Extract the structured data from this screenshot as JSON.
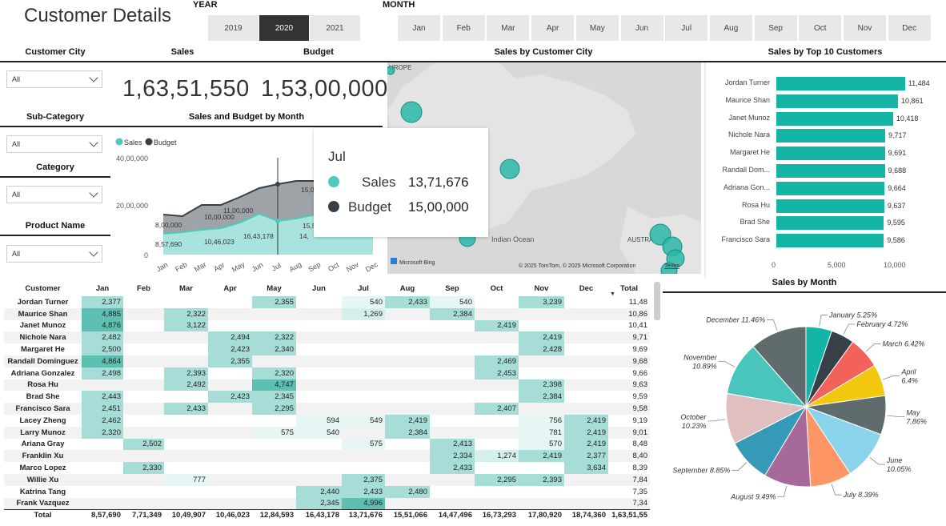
{
  "title": "Customer Details",
  "year": {
    "label": "YEAR",
    "options": [
      "2019",
      "2020",
      "2021"
    ],
    "selected": "2020"
  },
  "month": {
    "label": "MONTH",
    "options": [
      "Jan",
      "Feb",
      "Mar",
      "Apr",
      "May",
      "Jun",
      "Jul",
      "Aug",
      "Sep",
      "Oct",
      "Nov",
      "Dec"
    ]
  },
  "filters": {
    "city": {
      "label": "Customer City",
      "value": "All"
    },
    "subcategory": {
      "label": "Sub-Category",
      "value": "All"
    },
    "category": {
      "label": "Category",
      "value": "All"
    },
    "product": {
      "label": "Product Name",
      "value": "All"
    }
  },
  "kpi": {
    "sales_label": "Sales",
    "sales_value": "1,63,51,550",
    "budget_label": "Budget",
    "budget_value": "1,53,00,000"
  },
  "line_chart": {
    "title": "Sales and Budget by Month",
    "legend": [
      "Sales",
      "Budget"
    ],
    "ytick_labels": [
      "40,00,000",
      "20,00,000",
      "0"
    ],
    "month_labels": [
      "Jan",
      "Feb",
      "Mar",
      "Apr",
      "May",
      "Jun",
      "Jul",
      "Aug",
      "Sep",
      "Oct",
      "Nov",
      "Dec"
    ],
    "visible_labels": [
      "8,00,000",
      "8,57,690",
      "10,00,000",
      "10,46,023",
      "11,00,000",
      "16,43,178",
      "15,00,000",
      "15,51,0",
      "14,"
    ],
    "colors": {
      "sales": "#4ec9be",
      "budget": "#374047"
    }
  },
  "map": {
    "title": "Sales by Customer City",
    "labels": {
      "europe": "UROPE",
      "ocean": "Indian Ocean",
      "aus": "AUSTRA"
    },
    "bing": "Microsoft Bing",
    "copyright": "© 2025 TomTom, © 2025 Microsoft Corporation",
    "terms": "Terms",
    "bubble_color": "#2ab7a9"
  },
  "tooltip": {
    "month": "Jul",
    "sales_label": "Sales",
    "sales_value": "13,71,676",
    "budget_label": "Budget",
    "budget_value": "15,00,000"
  },
  "top10": {
    "title": "Sales by Top 10 Customers",
    "axis": [
      "0",
      "5,000",
      "10,000"
    ],
    "bar_color": "#14b5a6",
    "items": [
      {
        "name": "Jordan Turner",
        "value": 11484,
        "label": "11,484"
      },
      {
        "name": "Maurice Shan",
        "value": 10861,
        "label": "10,861"
      },
      {
        "name": "Janet Munoz",
        "value": 10418,
        "label": "10,418"
      },
      {
        "name": "Nichole Nara",
        "value": 9717,
        "label": "9,717"
      },
      {
        "name": "Margaret He",
        "value": 9691,
        "label": "9,691"
      },
      {
        "name": "Randall Dom...",
        "value": 9688,
        "label": "9,688"
      },
      {
        "name": "Adriana Gon...",
        "value": 9664,
        "label": "9,664"
      },
      {
        "name": "Rosa Hu",
        "value": 9637,
        "label": "9,637"
      },
      {
        "name": "Brad She",
        "value": 9595,
        "label": "9,595"
      },
      {
        "name": "Francisco Sara",
        "value": 9586,
        "label": "9,586"
      }
    ]
  },
  "pie": {
    "title": "Sales by Month",
    "slices": [
      {
        "label": "January 5.25%",
        "value": 5.25,
        "color": "#14b5a6"
      },
      {
        "label": "February 4.72%",
        "value": 4.72,
        "color": "#374047"
      },
      {
        "label": "March 6.42%",
        "value": 6.42,
        "color": "#f2625b"
      },
      {
        "label": "April 6.4%",
        "value": 6.4,
        "color": "#f2c80f"
      },
      {
        "label": "May 7.86%",
        "value": 7.86,
        "color": "#5f6b6d"
      },
      {
        "label": "June 10.05%",
        "value": 10.05,
        "color": "#8ad4eb"
      },
      {
        "label": "July 8.39%",
        "value": 8.39,
        "color": "#fe9666"
      },
      {
        "label": "August 9.49%",
        "value": 9.49,
        "color": "#a66999"
      },
      {
        "label": "September 8.85%",
        "value": 8.85,
        "color": "#3599b8"
      },
      {
        "label": "October 10.23%",
        "value": 10.23,
        "color": "#dfbfbf"
      },
      {
        "label": "November 10.89%",
        "value": 10.89,
        "color": "#4ac5bb"
      },
      {
        "label": "December 11.46%",
        "value": 11.46,
        "color": "#5f6b6d"
      }
    ]
  },
  "matrix": {
    "headers": [
      "Customer",
      "Jan",
      "Feb",
      "Mar",
      "Apr",
      "May",
      "Jun",
      "Jul",
      "Aug",
      "Sep",
      "Oct",
      "Nov",
      "Dec",
      "Total"
    ],
    "rows": [
      [
        "Jordan Turner",
        "2,377",
        "",
        "",
        "",
        "2,355",
        "",
        "540",
        "2,433",
        "540",
        "",
        "3,239",
        "",
        "11,48"
      ],
      [
        "Maurice Shan",
        "4,885",
        "",
        "2,322",
        "",
        "",
        "",
        "1,269",
        "",
        "2,384",
        "",
        "",
        "",
        "10,86"
      ],
      [
        "Janet Munoz",
        "4,876",
        "",
        "3,122",
        "",
        "",
        "",
        "",
        "",
        "",
        "2,419",
        "",
        "",
        "10,41"
      ],
      [
        "Nichole Nara",
        "2,482",
        "",
        "",
        "2,494",
        "2,322",
        "",
        "",
        "",
        "",
        "",
        "2,419",
        "",
        "9,71"
      ],
      [
        "Margaret He",
        "2,500",
        "",
        "",
        "2,423",
        "2,340",
        "",
        "",
        "",
        "",
        "",
        "2,428",
        "",
        "9,69"
      ],
      [
        "Randall Dominguez",
        "4,864",
        "",
        "",
        "2,355",
        "",
        "",
        "",
        "",
        "",
        "2,469",
        "",
        "",
        "9,68"
      ],
      [
        "Adriana Gonzalez",
        "2,498",
        "",
        "2,393",
        "",
        "2,320",
        "",
        "",
        "",
        "",
        "2,453",
        "",
        "",
        "9,66"
      ],
      [
        "Rosa Hu",
        "",
        "",
        "2,492",
        "",
        "4,747",
        "",
        "",
        "",
        "",
        "",
        "2,398",
        "",
        "9,63"
      ],
      [
        "Brad She",
        "2,443",
        "",
        "",
        "2,423",
        "2,345",
        "",
        "",
        "",
        "",
        "",
        "2,384",
        "",
        "9,59"
      ],
      [
        "Francisco Sara",
        "2,451",
        "",
        "2,433",
        "",
        "2,295",
        "",
        "",
        "",
        "",
        "2,407",
        "",
        "",
        "9,58"
      ],
      [
        "Lacey Zheng",
        "2,462",
        "",
        "",
        "",
        "",
        "594",
        "549",
        "2,419",
        "",
        "",
        "756",
        "2,419",
        "9,19"
      ],
      [
        "Larry Munoz",
        "2,320",
        "",
        "",
        "",
        "575",
        "540",
        "",
        "2,384",
        "",
        "",
        "781",
        "2,419",
        "9,01"
      ],
      [
        "Ariana Gray",
        "",
        "2,502",
        "",
        "",
        "",
        "",
        "575",
        "",
        "2,413",
        "",
        "570",
        "2,419",
        "8,48"
      ],
      [
        "Franklin Xu",
        "",
        "",
        "",
        "",
        "",
        "",
        "",
        "",
        "2,334",
        "1,274",
        "2,419",
        "2,377",
        "8,40"
      ],
      [
        "Marco Lopez",
        "",
        "2,330",
        "",
        "",
        "",
        "",
        "",
        "",
        "2,433",
        "",
        "",
        "3,634",
        "8,39"
      ],
      [
        "Willie Xu",
        "",
        "",
        "777",
        "",
        "",
        "",
        "2,375",
        "",
        "",
        "2,295",
        "2,393",
        "",
        "7,84"
      ],
      [
        "Katrina Tang",
        "",
        "",
        "",
        "",
        "",
        "2,440",
        "2,433",
        "2,480",
        "",
        "",
        "",
        "",
        "7,35"
      ],
      [
        "Frank Vazquez",
        "",
        "",
        "",
        "",
        "",
        "2,345",
        "4,996",
        "",
        "",
        "",
        "",
        "",
        "7,34"
      ]
    ],
    "total": [
      "Total",
      "8,57,690",
      "7,71,349",
      "10,49,907",
      "10,46,023",
      "12,84,593",
      "16,43,178",
      "13,71,676",
      "15,51,066",
      "14,47,496",
      "16,73,293",
      "17,80,920",
      "18,74,360",
      "1,63,51,55"
    ]
  }
}
